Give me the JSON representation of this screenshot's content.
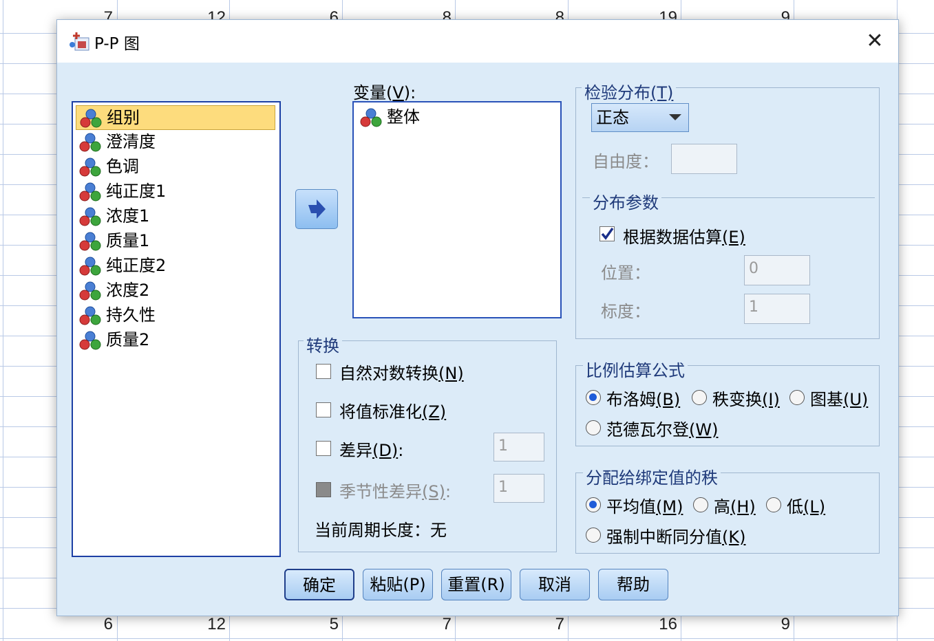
{
  "sheet": {
    "top_row": [
      "7",
      "12",
      "6",
      "8",
      "8",
      "19",
      "9"
    ],
    "bottom_row": [
      "6",
      "12",
      "5",
      "7",
      "7",
      "16",
      "9"
    ]
  },
  "dialog": {
    "title": "P-P 图",
    "close_symbol": "✕"
  },
  "source_list": {
    "items": [
      "组别",
      "澄清度",
      "色调",
      "纯正度1",
      "浓度1",
      "质量1",
      "纯正度2",
      "浓度2",
      "持久性",
      "质量2"
    ],
    "selected_index": 0
  },
  "variables": {
    "label": "变量",
    "mnemonic": "V",
    "suffix": ":",
    "items": [
      "整体"
    ]
  },
  "transform": {
    "title": "转换",
    "natural_log": {
      "label": "自然对数转换",
      "mnemonic": "(N)",
      "checked": false
    },
    "standardize": {
      "label": "将值标准化",
      "mnemonic": "(Z)",
      "checked": false
    },
    "difference": {
      "label": "差异",
      "mnemonic": "(D)",
      "suffix": ":",
      "checked": false,
      "value": "1"
    },
    "seasonal": {
      "label": "季节性差异",
      "mnemonic": "(S)",
      "suffix": ":",
      "checked": false,
      "value": "1"
    },
    "period_label": "当前周期长度：无"
  },
  "test_dist": {
    "title": "检验分布",
    "mnemonic": "(T)",
    "selected": "正态",
    "df_label": "自由度：",
    "df_value": "",
    "params_title": "分布参数",
    "estimate": {
      "label": "根据数据估算",
      "mnemonic": "(E)",
      "checked": true
    },
    "location_label": "位置：",
    "location_value": "0",
    "scale_label": "标度：",
    "scale_value": "1"
  },
  "proportion": {
    "title": "比例估算公式",
    "options": [
      {
        "label": "布洛姆",
        "mnemonic": "(B)",
        "selected": true
      },
      {
        "label": "秩变换",
        "mnemonic": "(I)",
        "selected": false
      },
      {
        "label": "图基",
        "mnemonic": "(U)",
        "selected": false
      },
      {
        "label": "范德瓦尔登",
        "mnemonic": "(W)",
        "selected": false
      }
    ]
  },
  "ties": {
    "title": "分配给绑定值的秩",
    "options": [
      {
        "label": "平均值",
        "mnemonic": "(M)",
        "selected": true
      },
      {
        "label": "高",
        "mnemonic": "(H)",
        "selected": false
      },
      {
        "label": "低",
        "mnemonic": "(L)",
        "selected": false
      },
      {
        "label": "强制中断同分值",
        "mnemonic": "(K)",
        "selected": false
      }
    ]
  },
  "buttons": {
    "ok": "确定",
    "paste": "粘贴(P)",
    "reset": "重置(R)",
    "cancel": "取消",
    "help": "帮助"
  },
  "colors": {
    "dialog_bg": "#dcebf8",
    "selection": "#fddc7d",
    "group_title": "#1f3a7a",
    "radio_dot": "#1f5bd8"
  }
}
